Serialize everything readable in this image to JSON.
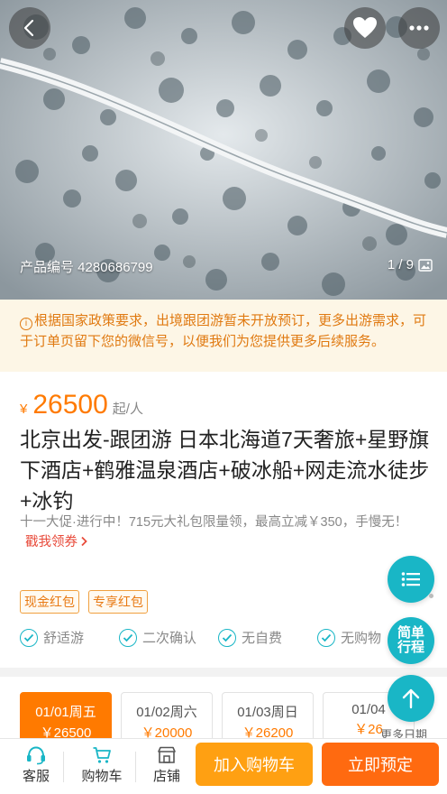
{
  "hero": {
    "product_id_label": "产品编号 4280686799",
    "image_counter": "1 / 9",
    "back_icon": "chevron-left-icon",
    "favorite_icon": "heart-icon",
    "more_icon": "ellipsis-icon"
  },
  "notice": {
    "icon": "info-icon",
    "text": "根据国家政策要求，出境跟团游暂未开放预订，更多出游需求，可于订单页留下您的微信号，以便我们为您提供更多后续服务。"
  },
  "product": {
    "currency": "¥",
    "price": "26500",
    "price_unit": "起/人",
    "title": "北京出发-跟团游 日本北海道7天奢旅+星野旗下酒店+鹤雅温泉酒店+破冰船+网走流水徒步+冰钓",
    "promo_text": "十一大促·进行中！715元大礼包限量领，最高立减￥350，手慢无！",
    "promo_link": "戳我领券",
    "coupons": [
      "现金红包",
      "专享红包"
    ],
    "features": [
      "舒适游",
      "二次确认",
      "无自费",
      "无购物"
    ]
  },
  "dates": {
    "items": [
      {
        "date": "01/01周五",
        "price": "￥26500"
      },
      {
        "date": "01/02周六",
        "price": "￥20000"
      },
      {
        "date": "01/03周日",
        "price": "￥26200"
      },
      {
        "date": "01/04",
        "price": "￥26"
      }
    ],
    "more_label": "更多日期"
  },
  "floating": {
    "route_label_1": "简单",
    "route_label_2": "行程",
    "list_icon": "list-icon",
    "top_icon": "arrow-up-icon"
  },
  "bottom_bar": {
    "customer_service": "客服",
    "cart": "购物车",
    "shop": "店铺",
    "add_to_cart": "加入购物车",
    "book_now": "立即预定"
  },
  "colors": {
    "accent_orange": "#ff7a00",
    "teal": "#19b6c6",
    "notice_bg": "#fdf6e6"
  }
}
